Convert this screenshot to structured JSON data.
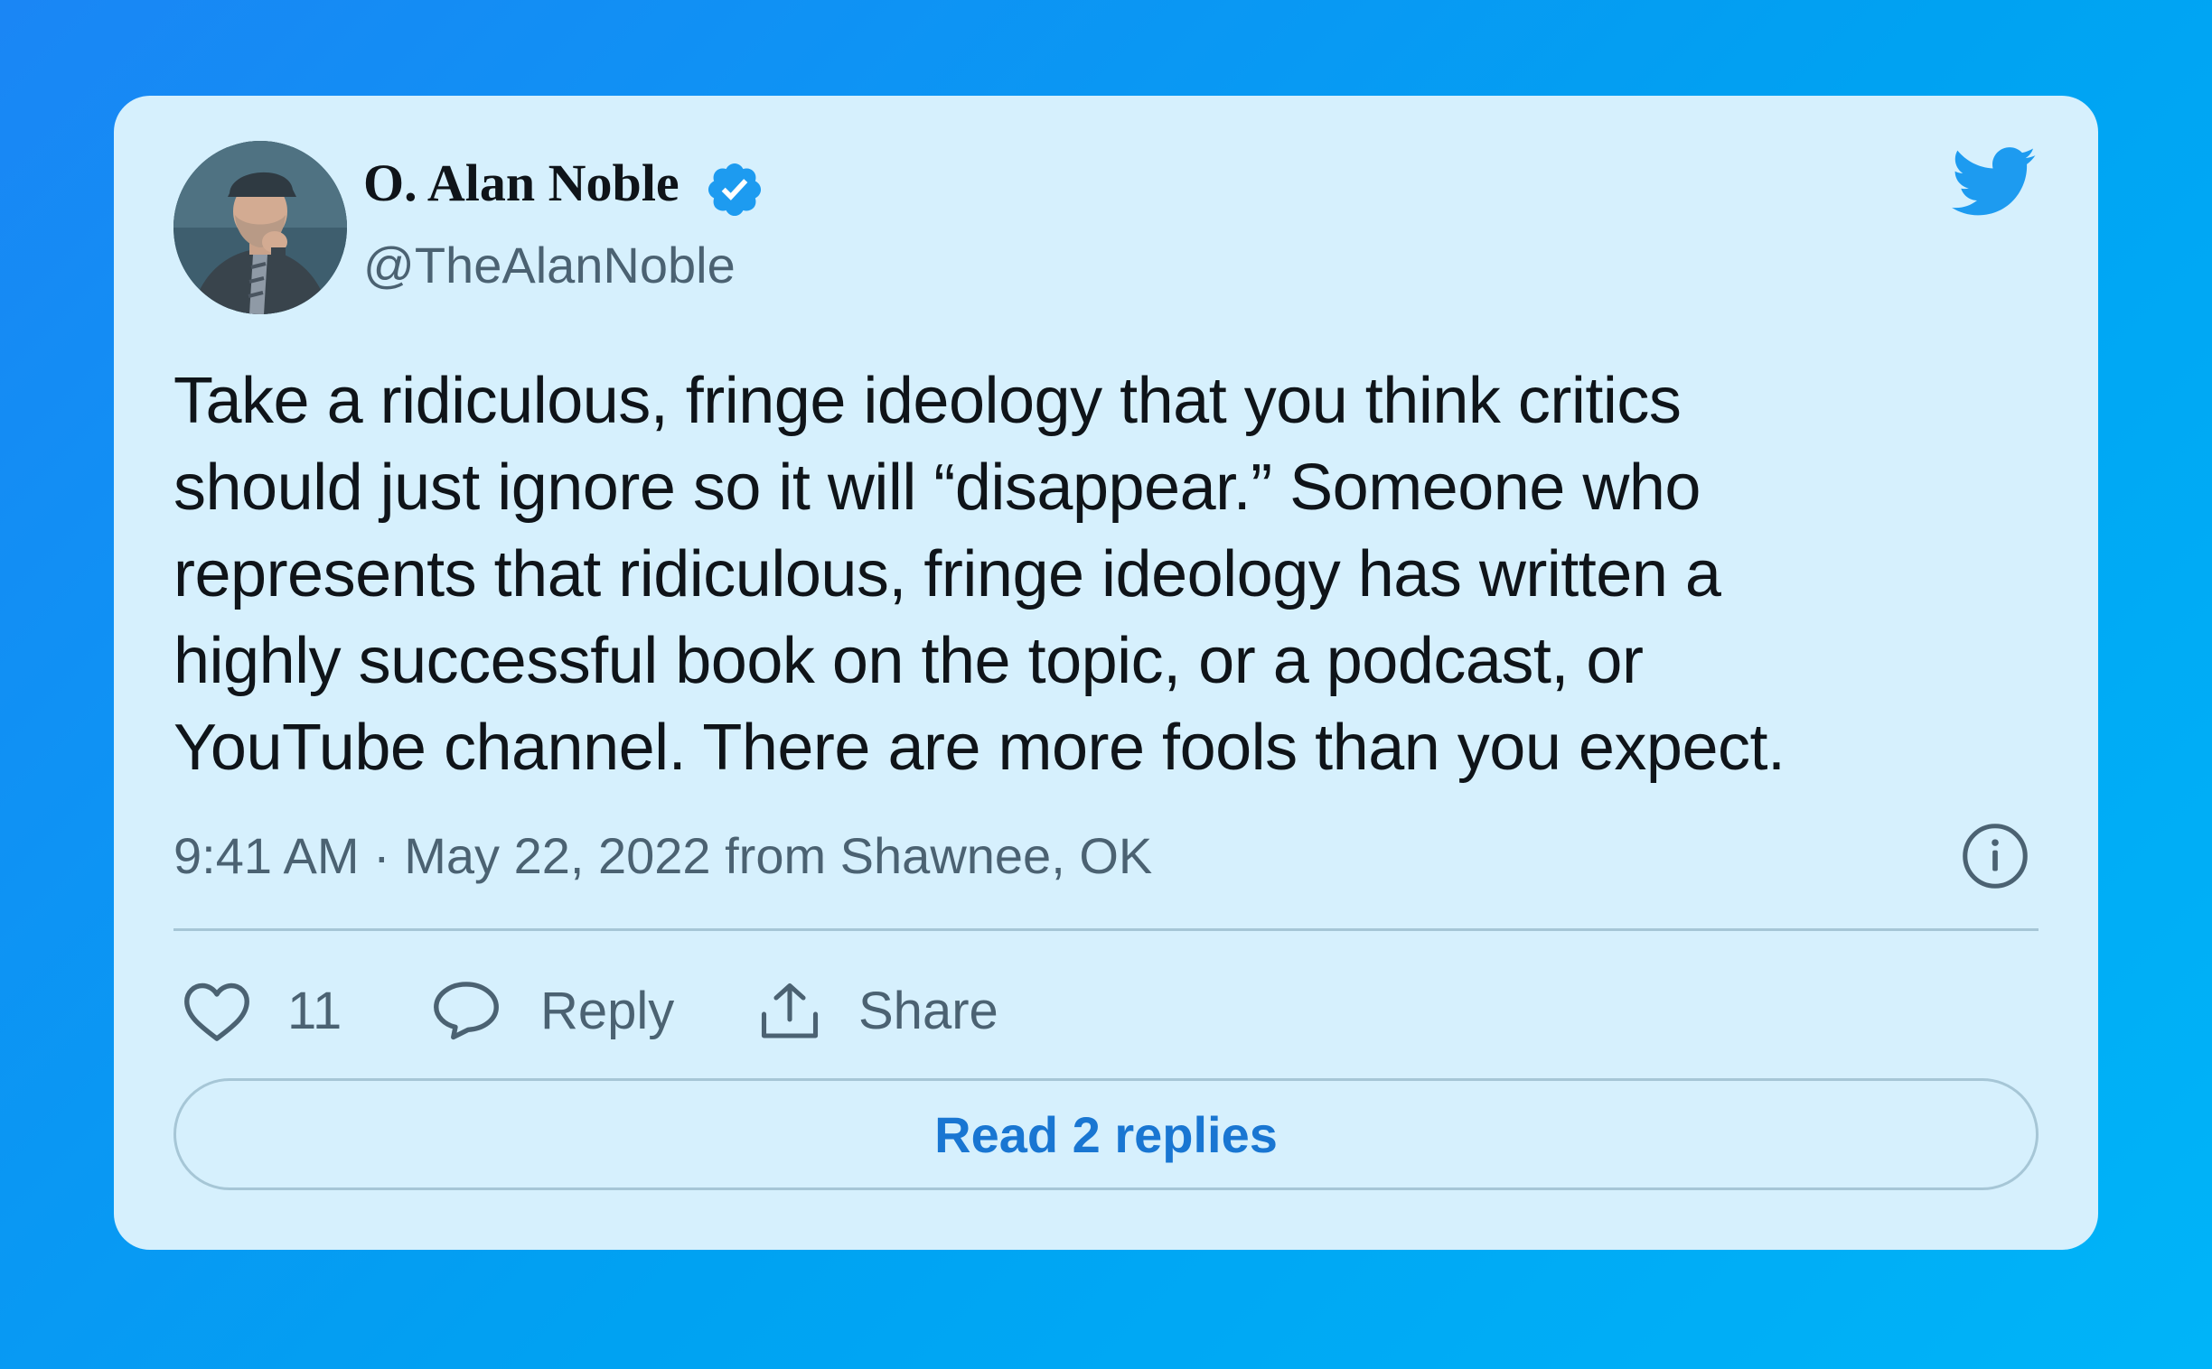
{
  "tweet": {
    "author": {
      "name": "O. Alan Noble",
      "handle": "@TheAlanNoble",
      "verified": true,
      "avatar_icon": "profile-photo"
    },
    "text_lines": [
      "Take a ridiculous, fringe ideology that you think critics",
      "should just ignore so it will “disappear.” Someone who",
      "represents that ridiculous, fringe ideology has written a",
      "highly successful book on the topic, or a podcast, or",
      "YouTube channel. There are more fools than you expect."
    ],
    "meta": "9:41 AM · May 22, 2022 from Shawnee, OK",
    "actions": {
      "like_count": "11",
      "reply_label": "Reply",
      "share_label": "Share"
    },
    "read_replies_label": "Read 2 replies"
  },
  "icons": {
    "brand": "twitter-bird-icon",
    "verified": "verified-badge-icon",
    "info": "info-icon",
    "like": "heart-icon",
    "reply": "speech-bubble-icon",
    "share": "share-upload-icon"
  },
  "colors": {
    "background_gradient_start": "#1a86f5",
    "background_gradient_end": "#00b4f8",
    "card": "#d6f0fd",
    "text_primary": "#0f1419",
    "text_secondary": "#4b6272",
    "accent": "#1d9bf0",
    "link": "#1976d2",
    "divider": "#a6c6d6"
  }
}
